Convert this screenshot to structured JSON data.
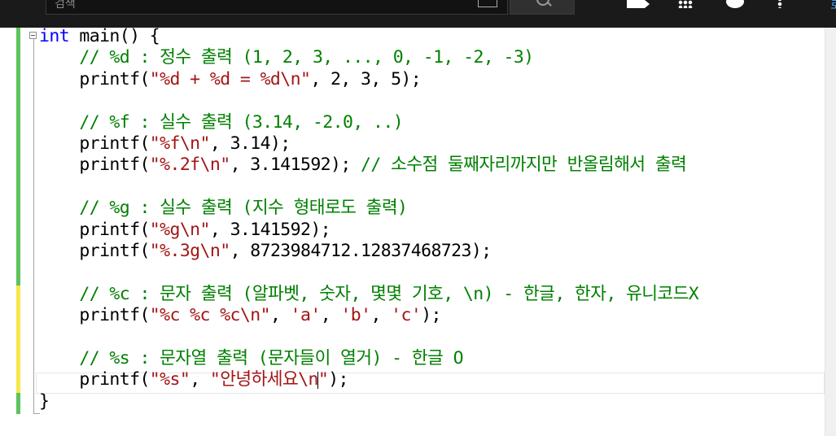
{
  "topbar": {
    "search_placeholder": "검색",
    "right_edge_text": "로",
    "icons": [
      "keyboard-icon",
      "search-icon",
      "create-video-icon",
      "apps-grid-icon",
      "messages-icon",
      "more-options-icon"
    ]
  },
  "editor": {
    "lines": [
      {
        "parts": [
          {
            "t": "int",
            "c": "kw"
          },
          {
            "t": " main() {",
            "c": ""
          }
        ]
      },
      {
        "parts": [
          {
            "t": "    // %d : 정수 출력 (1, 2, 3, ..., 0, -1, -2, -3)",
            "c": "cm"
          }
        ]
      },
      {
        "parts": [
          {
            "t": "    printf(",
            "c": ""
          },
          {
            "t": "\"%d + %d = %d\\n\"",
            "c": "str"
          },
          {
            "t": ", 2, 3, 5);",
            "c": ""
          }
        ]
      },
      {
        "parts": []
      },
      {
        "parts": [
          {
            "t": "    // %f : 실수 출력 (3.14, -2.0, ..)",
            "c": "cm"
          }
        ]
      },
      {
        "parts": [
          {
            "t": "    printf(",
            "c": ""
          },
          {
            "t": "\"%f\\n\"",
            "c": "str"
          },
          {
            "t": ", 3.14);",
            "c": ""
          }
        ]
      },
      {
        "parts": [
          {
            "t": "    printf(",
            "c": ""
          },
          {
            "t": "\"%.2f\\n\"",
            "c": "str"
          },
          {
            "t": ", 3.141592); ",
            "c": ""
          },
          {
            "t": "// 소수점 둘째자리까지만 반올림해서 출력",
            "c": "cm"
          }
        ]
      },
      {
        "parts": []
      },
      {
        "parts": [
          {
            "t": "    // %g : 실수 출력 (지수 형태로도 출력)",
            "c": "cm"
          }
        ]
      },
      {
        "parts": [
          {
            "t": "    printf(",
            "c": ""
          },
          {
            "t": "\"%g\\n\"",
            "c": "str"
          },
          {
            "t": ", 3.141592);",
            "c": ""
          }
        ]
      },
      {
        "parts": [
          {
            "t": "    printf(",
            "c": ""
          },
          {
            "t": "\"%.3g\\n\"",
            "c": "str"
          },
          {
            "t": ", 8723984712.12837468723);",
            "c": ""
          }
        ]
      },
      {
        "parts": []
      },
      {
        "parts": [
          {
            "t": "    // %c : 문자 출력 (알파벳, 숫자, 몇몇 기호, \\n) - 한글, 한자, 유니코드X",
            "c": "cm"
          }
        ]
      },
      {
        "parts": [
          {
            "t": "    printf(",
            "c": ""
          },
          {
            "t": "\"%c %c %c\\n\"",
            "c": "str"
          },
          {
            "t": ", ",
            "c": ""
          },
          {
            "t": "'a'",
            "c": "str"
          },
          {
            "t": ", ",
            "c": ""
          },
          {
            "t": "'b'",
            "c": "str"
          },
          {
            "t": ", ",
            "c": ""
          },
          {
            "t": "'c'",
            "c": "str"
          },
          {
            "t": ");",
            "c": ""
          }
        ]
      },
      {
        "parts": []
      },
      {
        "parts": [
          {
            "t": "    // %s : 문자열 출력 (문자들이 열거) - 한글 O",
            "c": "cm"
          }
        ]
      },
      {
        "parts": [
          {
            "t": "    printf(",
            "c": ""
          },
          {
            "t": "\"%s\"",
            "c": "str"
          },
          {
            "t": ", ",
            "c": ""
          },
          {
            "t": "\"안녕하세요\\n",
            "c": "str"
          },
          {
            "t": "CARET",
            "c": "caret"
          },
          {
            "t": "\"",
            "c": "str"
          },
          {
            "t": ");",
            "c": ""
          }
        ]
      },
      {
        "parts": [
          {
            "t": "}",
            "c": ""
          }
        ]
      }
    ],
    "change_markers": [
      {
        "from_line": 0,
        "to_line": 11,
        "color": "#5ec25e"
      },
      {
        "from_line": 12,
        "to_line": 16,
        "color": "#f7e84a"
      },
      {
        "from_line": 17,
        "to_line": 17,
        "color": "#5ec25e"
      }
    ]
  }
}
